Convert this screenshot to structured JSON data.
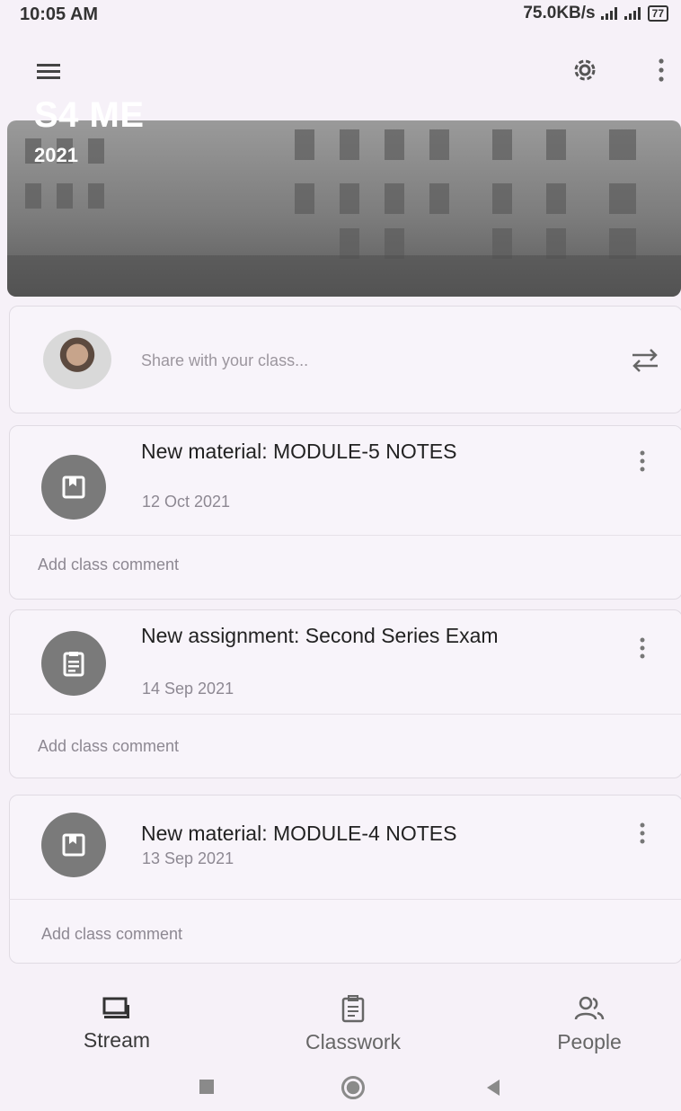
{
  "status_bar": {
    "time": "10:05 AM",
    "network_speed": "75.0KB/s",
    "battery": "77"
  },
  "top_bar": {
    "menu_icon": "hamburger-menu-icon",
    "settings_icon": "gear-icon",
    "more_icon": "more-vertical-icon"
  },
  "banner": {
    "title": "S4 ME",
    "year": "2021"
  },
  "share": {
    "placeholder": "Share with your class...",
    "repost_icon": "repost-icon"
  },
  "posts": [
    {
      "icon": "material-icon",
      "title": "New material: MODULE-5 NOTES",
      "date": "12 Oct 2021",
      "comment_label": "Add class comment"
    },
    {
      "icon": "assignment-icon",
      "title": "New assignment: Second Series Exam",
      "date": "14 Sep 2021",
      "comment_label": "Add class comment"
    },
    {
      "icon": "material-icon",
      "title": "New material: MODULE-4 NOTES",
      "date": "13 Sep 2021",
      "comment_label": "Add class comment"
    }
  ],
  "bottom_nav": {
    "items": [
      {
        "label": "Stream",
        "icon": "stream-icon",
        "active": true
      },
      {
        "label": "Classwork",
        "icon": "classwork-icon",
        "active": false
      },
      {
        "label": "People",
        "icon": "people-icon",
        "active": false
      }
    ]
  },
  "system_nav": {
    "recents_icon": "square-icon",
    "home_icon": "circle-icon",
    "back_icon": "back-triangle-icon"
  }
}
